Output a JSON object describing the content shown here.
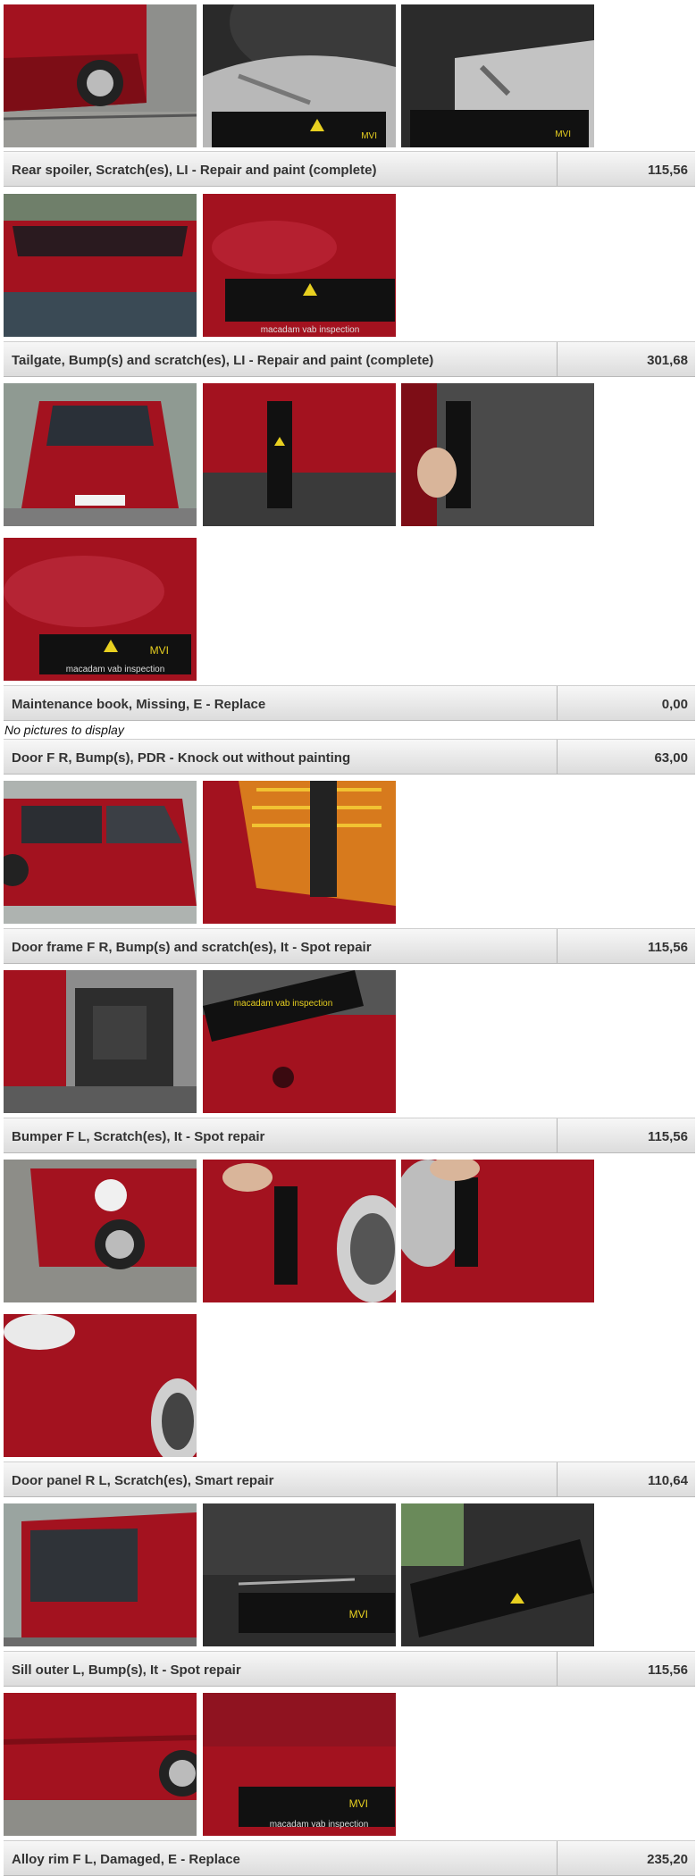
{
  "items": [
    {
      "description": "Rear spoiler, Scratch(es), LI - Repair and paint (complete)",
      "price": "115,56"
    },
    {
      "description": "Tailgate, Bump(s) and scratch(es), LI - Repair and paint (complete)",
      "price": "301,68"
    },
    {
      "description": "Maintenance book, Missing, E - Replace",
      "price": "0,00"
    },
    {
      "description": "Door F R, Bump(s), PDR - Knock out without painting",
      "price": "63,00"
    },
    {
      "description": "Door frame F R, Bump(s) and scratch(es), It - Spot repair",
      "price": "115,56"
    },
    {
      "description": "Bumper F L, Scratch(es), It - Spot repair",
      "price": "115,56"
    },
    {
      "description": "Door panel R L, Scratch(es), Smart repair",
      "price": "110,64"
    },
    {
      "description": "Sill outer L, Bump(s), It - Spot repair",
      "price": "115,56"
    },
    {
      "description": "Alloy rim F L, Damaged, E - Replace",
      "price": "235,20"
    }
  ],
  "no_pictures_text": "No pictures to display",
  "ruler_brand": "MVI",
  "ruler_text": "macadam vab inspection",
  "colors": {
    "car_red": "#a3121f",
    "ruler_yellow": "#e8d020",
    "header_gray": "#e0e0e0"
  }
}
